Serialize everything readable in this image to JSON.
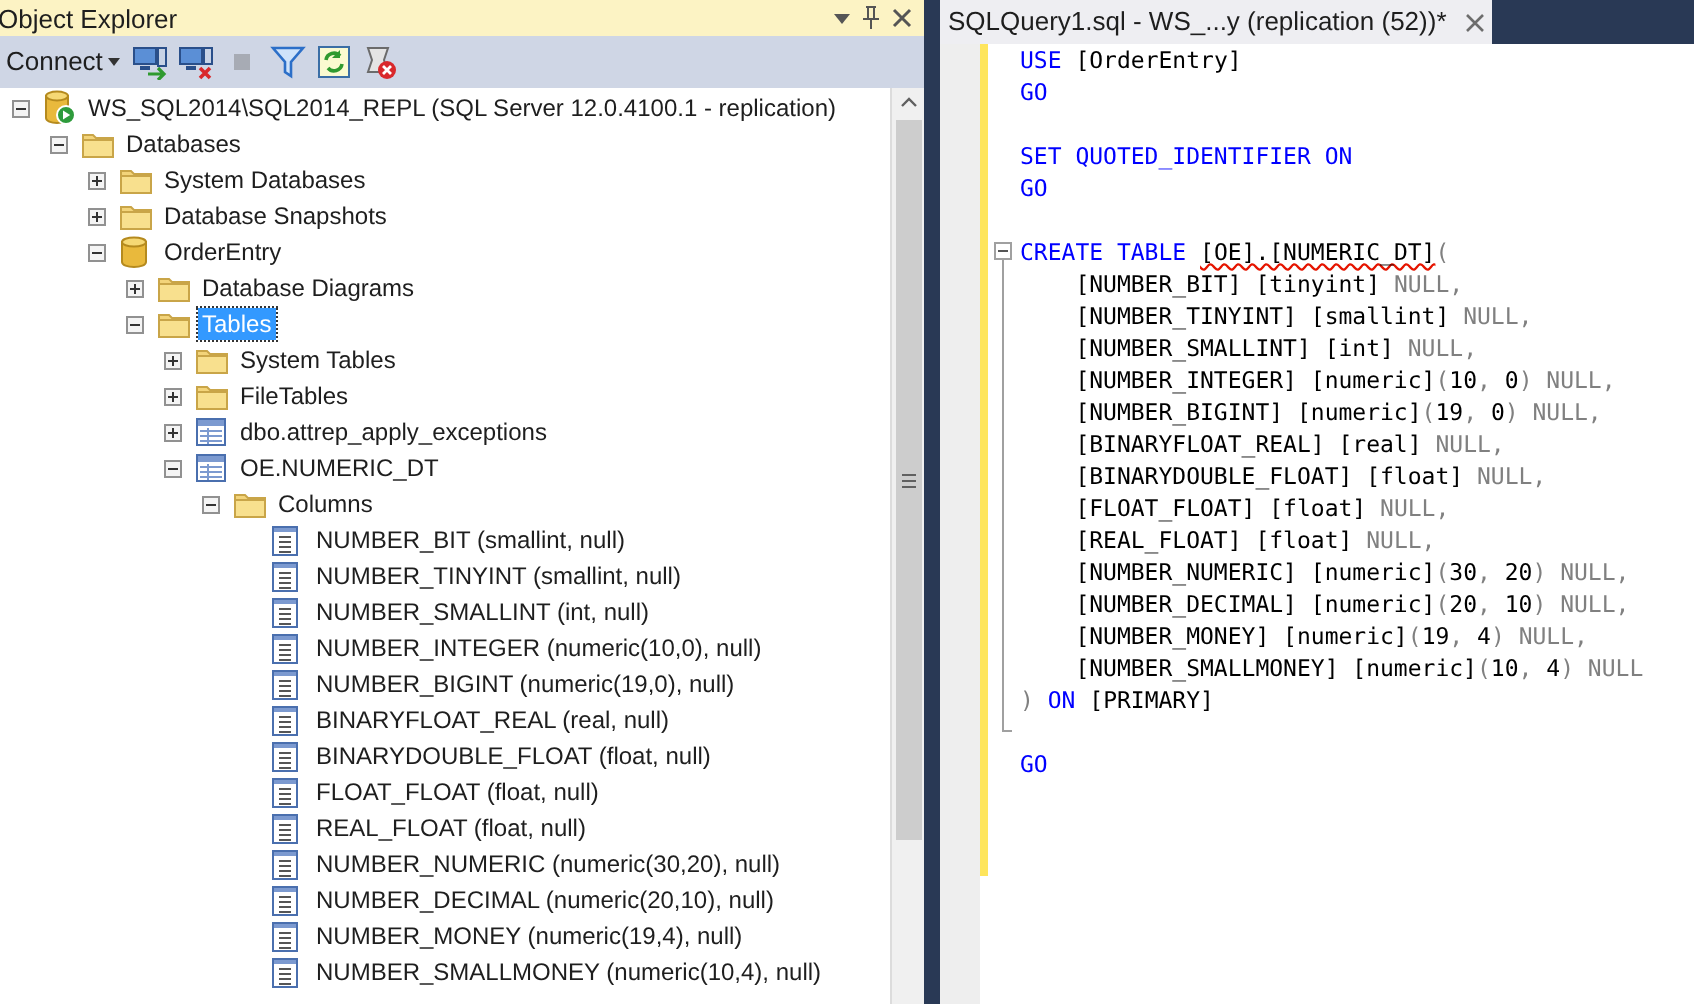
{
  "object_explorer": {
    "title": "Object Explorer",
    "toolbar": {
      "connect_label": "Connect",
      "tools": [
        {
          "kind": "connect",
          "disabled": false
        },
        {
          "kind": "disconnect",
          "disabled": false
        },
        {
          "kind": "stop",
          "disabled": true
        },
        {
          "kind": "filter",
          "disabled": false
        },
        {
          "kind": "refresh",
          "disabled": false
        },
        {
          "kind": "activity",
          "disabled": false
        }
      ]
    },
    "tree": [
      {
        "label": "WS_SQL2014\\SQL2014_REPL (SQL Server 12.0.4100.1 - replication)",
        "kind": "server",
        "expanded": true,
        "selected": false,
        "children": [
          {
            "label": "Databases",
            "kind": "folder",
            "expanded": true,
            "selected": false,
            "children": [
              {
                "label": "System Databases",
                "kind": "folder",
                "expanded": false,
                "selected": false
              },
              {
                "label": "Database Snapshots",
                "kind": "folder",
                "expanded": false,
                "selected": false
              },
              {
                "label": "OrderEntry",
                "kind": "database",
                "expanded": true,
                "selected": false,
                "children": [
                  {
                    "label": "Database Diagrams",
                    "kind": "folder",
                    "expanded": false,
                    "selected": false
                  },
                  {
                    "label": "Tables",
                    "kind": "folder",
                    "expanded": true,
                    "selected": true,
                    "children": [
                      {
                        "label": "System Tables",
                        "kind": "folder",
                        "expanded": false,
                        "selected": false
                      },
                      {
                        "label": "FileTables",
                        "kind": "folder",
                        "expanded": false,
                        "selected": false
                      },
                      {
                        "label": "dbo.attrep_apply_exceptions",
                        "kind": "table",
                        "expanded": false,
                        "selected": false
                      },
                      {
                        "label": "OE.NUMERIC_DT",
                        "kind": "table",
                        "expanded": true,
                        "selected": false,
                        "children": [
                          {
                            "label": "Columns",
                            "kind": "folder",
                            "expanded": true,
                            "selected": false,
                            "children": [
                              {
                                "label": "NUMBER_BIT (smallint, null)",
                                "kind": "column",
                                "selected": false
                              },
                              {
                                "label": "NUMBER_TINYINT (smallint, null)",
                                "kind": "column",
                                "selected": false
                              },
                              {
                                "label": "NUMBER_SMALLINT (int, null)",
                                "kind": "column",
                                "selected": false
                              },
                              {
                                "label": "NUMBER_INTEGER (numeric(10,0), null)",
                                "kind": "column",
                                "selected": false
                              },
                              {
                                "label": "NUMBER_BIGINT (numeric(19,0), null)",
                                "kind": "column",
                                "selected": false
                              },
                              {
                                "label": "BINARYFLOAT_REAL (real, null)",
                                "kind": "column",
                                "selected": false
                              },
                              {
                                "label": "BINARYDOUBLE_FLOAT (float, null)",
                                "kind": "column",
                                "selected": false
                              },
                              {
                                "label": "FLOAT_FLOAT (float, null)",
                                "kind": "column",
                                "selected": false
                              },
                              {
                                "label": "REAL_FLOAT (float, null)",
                                "kind": "column",
                                "selected": false
                              },
                              {
                                "label": "NUMBER_NUMERIC (numeric(30,20), null)",
                                "kind": "column",
                                "selected": false
                              },
                              {
                                "label": "NUMBER_DECIMAL (numeric(20,10), null)",
                                "kind": "column",
                                "selected": false
                              },
                              {
                                "label": "NUMBER_MONEY (numeric(19,4), null)",
                                "kind": "column",
                                "selected": false
                              },
                              {
                                "label": "NUMBER_SMALLMONEY (numeric(10,4), null)",
                                "kind": "column",
                                "selected": false
                              }
                            ]
                          }
                        ]
                      }
                    ]
                  }
                ]
              }
            ]
          }
        ]
      }
    ]
  },
  "editor": {
    "tab": {
      "title": "SQLQuery1.sql - WS_...y (replication (52))*",
      "selected": true
    },
    "lines": [
      {
        "kind": "code",
        "tokens": [
          {
            "kind": "keyword",
            "text": "USE"
          },
          {
            "kind": "plain",
            "text": " [OrderEntry]"
          }
        ]
      },
      {
        "kind": "code",
        "tokens": [
          {
            "kind": "keyword",
            "text": "GO"
          }
        ]
      },
      {
        "kind": "blank"
      },
      {
        "kind": "code",
        "tokens": [
          {
            "kind": "keyword",
            "text": "SET QUOTED_IDENTIFIER ON"
          }
        ]
      },
      {
        "kind": "code",
        "tokens": [
          {
            "kind": "keyword",
            "text": "GO"
          }
        ]
      },
      {
        "kind": "blank"
      },
      {
        "kind": "fold_start",
        "tokens": [
          {
            "kind": "keyword",
            "text": "CREATE TABLE "
          },
          {
            "kind": "error",
            "text": "[OE].[NUMERIC_DT]"
          },
          {
            "kind": "gray",
            "text": "("
          }
        ]
      },
      {
        "kind": "fold_inside",
        "tokens": [
          {
            "kind": "plain",
            "text": "    [NUMBER_BIT] [tinyint] "
          },
          {
            "kind": "gray",
            "text": "NULL,"
          }
        ]
      },
      {
        "kind": "fold_inside",
        "tokens": [
          {
            "kind": "plain",
            "text": "    [NUMBER_TINYINT] [smallint] "
          },
          {
            "kind": "gray",
            "text": "NULL,"
          }
        ]
      },
      {
        "kind": "fold_inside",
        "tokens": [
          {
            "kind": "plain",
            "text": "    [NUMBER_SMALLINT] [int] "
          },
          {
            "kind": "gray",
            "text": "NULL,"
          }
        ]
      },
      {
        "kind": "fold_inside",
        "tokens": [
          {
            "kind": "plain",
            "text": "    [NUMBER_INTEGER] [numeric]"
          },
          {
            "kind": "gray",
            "text": "("
          },
          {
            "kind": "plain",
            "text": "10"
          },
          {
            "kind": "gray",
            "text": ", "
          },
          {
            "kind": "plain",
            "text": "0"
          },
          {
            "kind": "gray",
            "text": ") NULL,"
          }
        ]
      },
      {
        "kind": "fold_inside",
        "tokens": [
          {
            "kind": "plain",
            "text": "    [NUMBER_BIGINT] [numeric]"
          },
          {
            "kind": "gray",
            "text": "("
          },
          {
            "kind": "plain",
            "text": "19"
          },
          {
            "kind": "gray",
            "text": ", "
          },
          {
            "kind": "plain",
            "text": "0"
          },
          {
            "kind": "gray",
            "text": ") NULL,"
          }
        ]
      },
      {
        "kind": "fold_inside",
        "tokens": [
          {
            "kind": "plain",
            "text": "    [BINARYFLOAT_REAL] [real] "
          },
          {
            "kind": "gray",
            "text": "NULL,"
          }
        ]
      },
      {
        "kind": "fold_inside",
        "tokens": [
          {
            "kind": "plain",
            "text": "    [BINARYDOUBLE_FLOAT] [float] "
          },
          {
            "kind": "gray",
            "text": "NULL,"
          }
        ]
      },
      {
        "kind": "fold_inside",
        "tokens": [
          {
            "kind": "plain",
            "text": "    [FLOAT_FLOAT] [float] "
          },
          {
            "kind": "gray",
            "text": "NULL,"
          }
        ]
      },
      {
        "kind": "fold_inside",
        "tokens": [
          {
            "kind": "plain",
            "text": "    [REAL_FLOAT] [float] "
          },
          {
            "kind": "gray",
            "text": "NULL,"
          }
        ]
      },
      {
        "kind": "fold_inside",
        "tokens": [
          {
            "kind": "plain",
            "text": "    [NUMBER_NUMERIC] [numeric]"
          },
          {
            "kind": "gray",
            "text": "("
          },
          {
            "kind": "plain",
            "text": "30"
          },
          {
            "kind": "gray",
            "text": ", "
          },
          {
            "kind": "plain",
            "text": "20"
          },
          {
            "kind": "gray",
            "text": ") NULL,"
          }
        ]
      },
      {
        "kind": "fold_inside",
        "tokens": [
          {
            "kind": "plain",
            "text": "    [NUMBER_DECIMAL] [numeric]"
          },
          {
            "kind": "gray",
            "text": "("
          },
          {
            "kind": "plain",
            "text": "20"
          },
          {
            "kind": "gray",
            "text": ", "
          },
          {
            "kind": "plain",
            "text": "10"
          },
          {
            "kind": "gray",
            "text": ") NULL,"
          }
        ]
      },
      {
        "kind": "fold_inside",
        "tokens": [
          {
            "kind": "plain",
            "text": "    [NUMBER_MONEY] [numeric]"
          },
          {
            "kind": "gray",
            "text": "("
          },
          {
            "kind": "plain",
            "text": "19"
          },
          {
            "kind": "gray",
            "text": ", "
          },
          {
            "kind": "plain",
            "text": "4"
          },
          {
            "kind": "gray",
            "text": ") NULL,"
          }
        ]
      },
      {
        "kind": "fold_inside",
        "tokens": [
          {
            "kind": "plain",
            "text": "    [NUMBER_SMALLMONEY] [numeric]"
          },
          {
            "kind": "gray",
            "text": "("
          },
          {
            "kind": "plain",
            "text": "10"
          },
          {
            "kind": "gray",
            "text": ", "
          },
          {
            "kind": "plain",
            "text": "4"
          },
          {
            "kind": "gray",
            "text": ") NULL"
          }
        ]
      },
      {
        "kind": "fold_inside",
        "tokens": [
          {
            "kind": "gray",
            "text": ")"
          },
          {
            "kind": "keyword",
            "text": " ON"
          },
          {
            "kind": "plain",
            "text": " [PRIMARY]"
          }
        ]
      },
      {
        "kind": "fold_end"
      },
      {
        "kind": "code",
        "tokens": [
          {
            "kind": "keyword",
            "text": "GO"
          }
        ]
      }
    ]
  }
}
